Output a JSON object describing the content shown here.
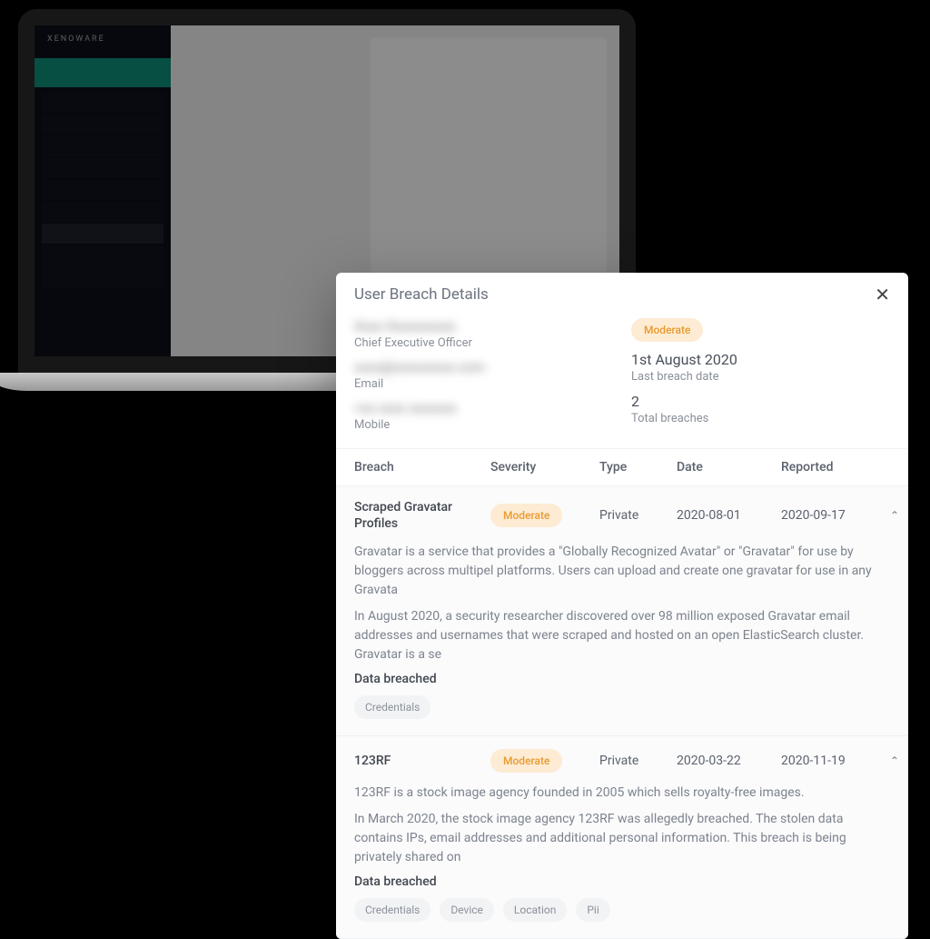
{
  "modal": {
    "title": "User Breach Details",
    "close_label": "✕",
    "summary": {
      "name_masked": "Xxxx Xxxxxxxxxx",
      "role": "Chief Executive Officer",
      "email_masked": "xxxx@xxxxxxxxx.com",
      "email_label": "Email",
      "mobile_masked": "+xx xxxx xxxxxxx",
      "mobile_label": "Mobile",
      "severity_badge": "Moderate",
      "last_breach_date": "1st August 2020",
      "last_breach_label": "Last breach date",
      "total_breaches": "2",
      "total_breaches_label": "Total breaches"
    },
    "columns": {
      "breach": "Breach",
      "severity": "Severity",
      "type": "Type",
      "date": "Date",
      "reported": "Reported"
    },
    "breaches": [
      {
        "name": "Scraped Gravatar Profiles",
        "severity": "Moderate",
        "type": "Private",
        "date": "2020-08-01",
        "reported": "2020-09-17",
        "desc1": "Gravatar is a service that provides a \"Globally Recognized Avatar\" or \"Gravatar\" for use by bloggers across multipel platforms. Users can upload and create one gravatar for use in any Gravata",
        "desc2": "In August 2020, a security researcher discovered over 98 million exposed Gravatar email addresses and usernames that were scraped and hosted on an open ElasticSearch cluster. Gravatar is a se",
        "data_label": "Data breached",
        "tags": [
          "Credentials"
        ]
      },
      {
        "name": "123RF",
        "severity": "Moderate",
        "type": "Private",
        "date": "2020-03-22",
        "reported": "2020-11-19",
        "desc1": "123RF is a stock image agency founded in 2005 which sells royalty-free images.",
        "desc2": "In March 2020, the stock image agency 123RF was allegedly breached. The stolen data contains IPs, email addresses and additional personal information. This breach is being privately shared on",
        "data_label": "Data breached",
        "tags": [
          "Credentials",
          "Device",
          "Location",
          "Pii"
        ]
      }
    ]
  },
  "laptop": {
    "brand": "XENOWARE"
  }
}
